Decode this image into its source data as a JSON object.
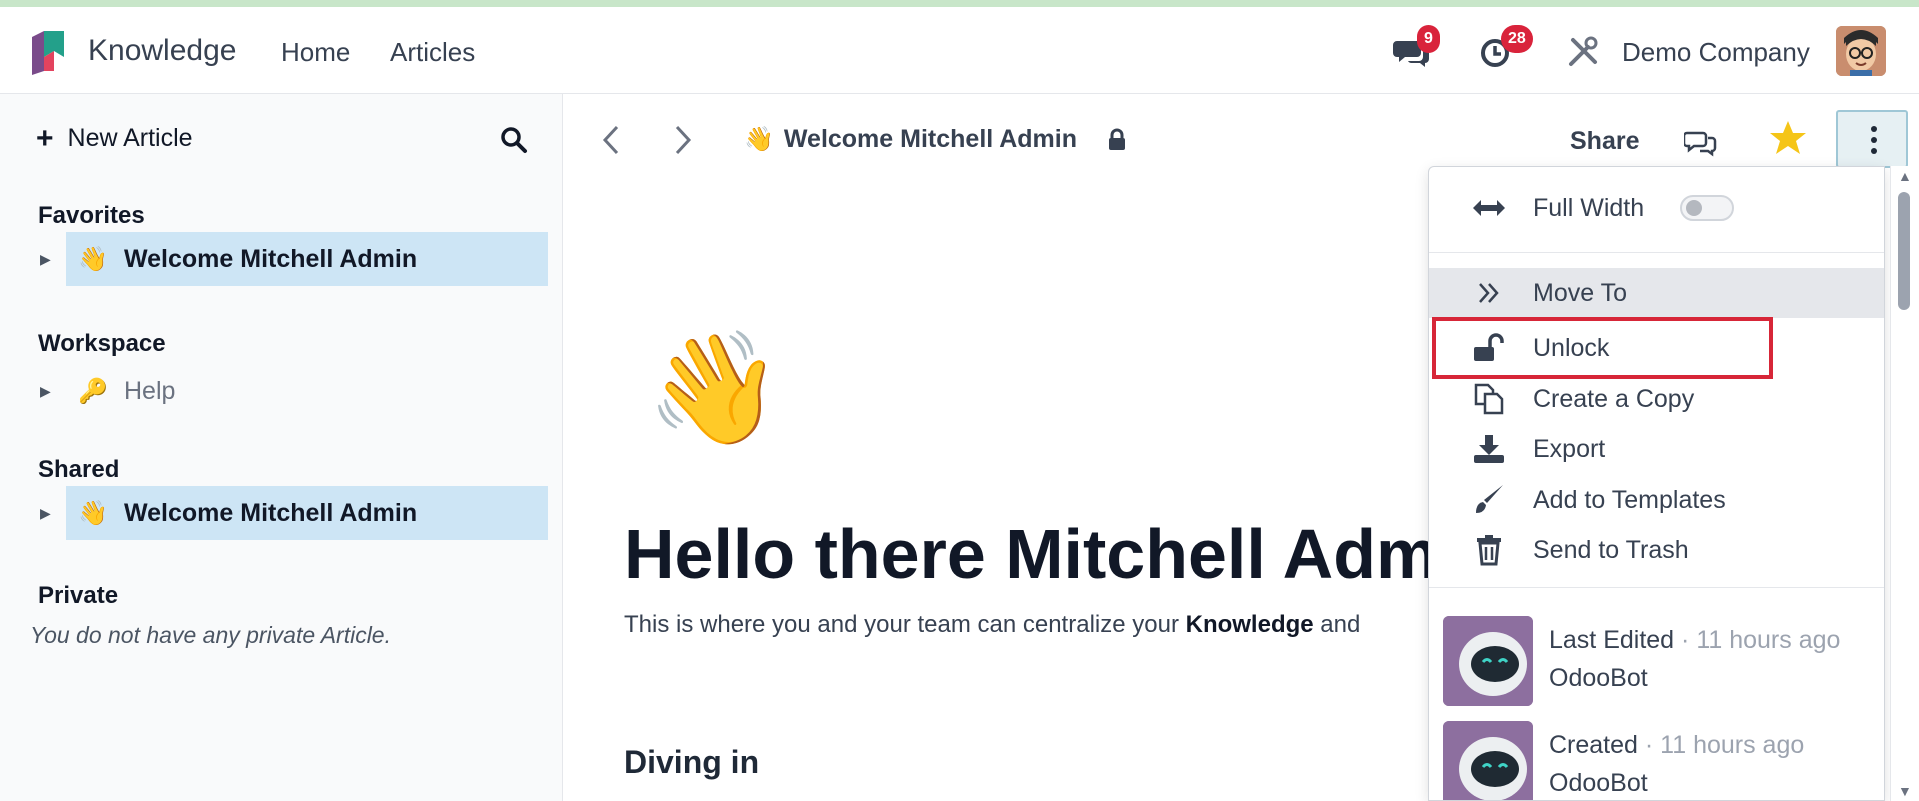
{
  "navbar": {
    "app_title": "Knowledge",
    "links": [
      "Home",
      "Articles"
    ],
    "messages_count": "9",
    "activities_count": "28",
    "company": "Demo Company"
  },
  "sidebar": {
    "new_article": "New Article",
    "favorites_title": "Favorites",
    "favorites_item": "Welcome Mitchell Admin",
    "workspace_title": "Workspace",
    "workspace_item": "Help",
    "shared_title": "Shared",
    "shared_item": "Welcome Mitchell Admin",
    "private_title": "Private",
    "private_empty": "You do not have any private Article."
  },
  "main": {
    "breadcrumb": "Welcome Mitchell Admin",
    "share_label": "Share",
    "hero_emoji": "👋",
    "title": "Hello there Mitchell Admin",
    "desc_before": "This is where you and your team can centralize your ",
    "desc_bold": "Knowledge",
    "desc_after": " and",
    "section": "Diving in"
  },
  "menu": {
    "full_width": "Full Width",
    "full_width_enabled": false,
    "move_to": "Move To",
    "unlock": "Unlock",
    "create_copy": "Create a Copy",
    "export": "Export",
    "add_templates": "Add to Templates",
    "send_trash": "Send to Trash",
    "last_edited_label": "Last Edited",
    "last_edited_time": "· 11 hours ago",
    "last_edited_by": "OdooBot",
    "created_label": "Created",
    "created_time": "· 11 hours ago",
    "created_by": "OdooBot"
  },
  "colors": {
    "accent_highlight": "#d72638",
    "active_item_bg": "#cde5f5",
    "badge": "#d9233b",
    "star": "#f5c518"
  }
}
